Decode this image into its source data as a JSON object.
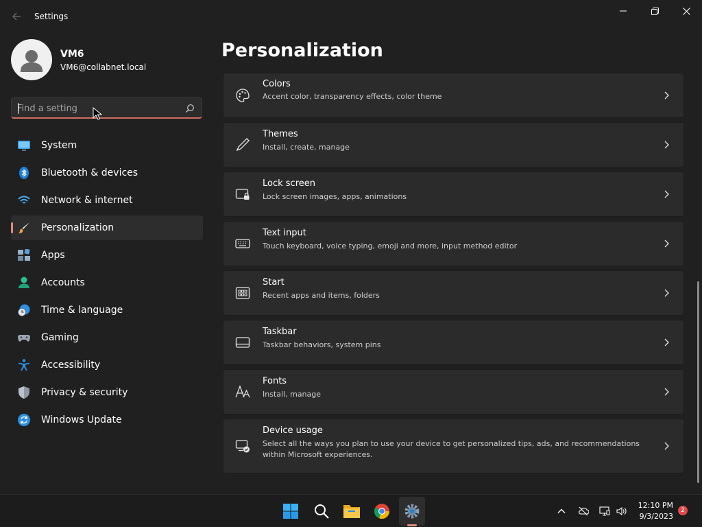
{
  "window": {
    "title": "Settings",
    "back_icon": "arrow-left-icon",
    "minimize_icon": "minimize-icon",
    "maximize_icon": "restore-icon",
    "close_icon": "close-icon"
  },
  "profile": {
    "name": "VM6",
    "email": "VM6@collabnet.local"
  },
  "search": {
    "placeholder": "Find a setting",
    "value": ""
  },
  "nav": {
    "items": [
      {
        "label": "System",
        "icon": "monitor-icon",
        "active": false
      },
      {
        "label": "Bluetooth & devices",
        "icon": "bluetooth-icon",
        "active": false
      },
      {
        "label": "Network & internet",
        "icon": "wifi-icon",
        "active": false
      },
      {
        "label": "Personalization",
        "icon": "brush-icon",
        "active": true
      },
      {
        "label": "Apps",
        "icon": "apps-icon",
        "active": false
      },
      {
        "label": "Accounts",
        "icon": "person-icon",
        "active": false
      },
      {
        "label": "Time & language",
        "icon": "globe-clock-icon",
        "active": false
      },
      {
        "label": "Gaming",
        "icon": "gamepad-icon",
        "active": false
      },
      {
        "label": "Accessibility",
        "icon": "accessibility-icon",
        "active": false
      },
      {
        "label": "Privacy & security",
        "icon": "shield-icon",
        "active": false
      },
      {
        "label": "Windows Update",
        "icon": "update-icon",
        "active": false
      }
    ]
  },
  "main": {
    "title": "Personalization",
    "cards": [
      {
        "title": "Colors",
        "desc": "Accent color, transparency effects, color theme",
        "icon": "palette-icon"
      },
      {
        "title": "Themes",
        "desc": "Install, create, manage",
        "icon": "pen-icon"
      },
      {
        "title": "Lock screen",
        "desc": "Lock screen images, apps, animations",
        "icon": "lock-screen-icon"
      },
      {
        "title": "Text input",
        "desc": "Touch keyboard, voice typing, emoji and more, input method editor",
        "icon": "keyboard-icon"
      },
      {
        "title": "Start",
        "desc": "Recent apps and items, folders",
        "icon": "start-grid-icon"
      },
      {
        "title": "Taskbar",
        "desc": "Taskbar behaviors, system pins",
        "icon": "taskbar-icon"
      },
      {
        "title": "Fonts",
        "desc": "Install, manage",
        "icon": "font-icon"
      },
      {
        "title": "Device usage",
        "desc": "Select all the ways you plan to use your device to get personalized tips, ads, and recommendations within Microsoft experiences.",
        "icon": "device-usage-icon"
      }
    ]
  },
  "taskbar": {
    "apps": [
      "windows-start-icon",
      "search-icon",
      "file-explorer-icon",
      "chrome-icon",
      "settings-gear-icon"
    ],
    "tray": [
      "chevron-up-icon",
      "onedrive-offline-icon",
      "network-icon",
      "volume-icon"
    ],
    "time": "12:10 PM",
    "date": "9/3/2023",
    "notifications": "2"
  },
  "colors": {
    "accent": "#e08a7a",
    "background": "#202020",
    "card": "#2b2b2b"
  }
}
